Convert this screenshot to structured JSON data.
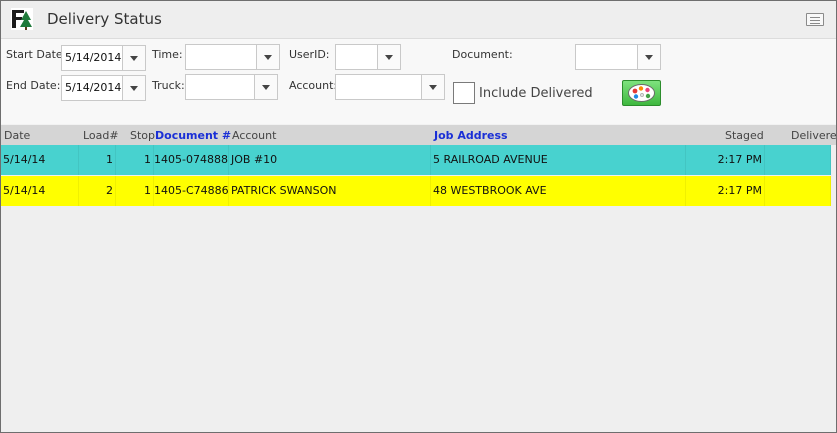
{
  "window": {
    "title": "Delivery Status"
  },
  "filters": {
    "start_date": {
      "label": "Start Date:",
      "value": "5/14/2014"
    },
    "end_date": {
      "label": "End Date:",
      "value": "5/14/2014"
    },
    "time": {
      "label": "Time:",
      "value": ""
    },
    "truck": {
      "label": "Truck:",
      "value": ""
    },
    "user_id": {
      "label": "UserID:",
      "value": ""
    },
    "account": {
      "label": "Account:",
      "value": ""
    },
    "document": {
      "label": "Document:",
      "value": ""
    },
    "include_delivered": {
      "label": "Include Delivered",
      "checked": false
    }
  },
  "table": {
    "columns": {
      "date": "Date",
      "load": "Load#",
      "stop": "Stop",
      "document": "Document #",
      "account": "Account",
      "job_address": "Job Address",
      "staged": "Staged",
      "delivered": "Delivere"
    },
    "rows": [
      {
        "date": "5/14/14",
        "load": "1",
        "stop": "1",
        "document": "1405-074888",
        "account": "JOB #10",
        "job_address": "5 RAILROAD AVENUE",
        "staged": "2:17 PM",
        "delivered": "",
        "color": "#48d2cf"
      },
      {
        "date": "5/14/14",
        "load": "2",
        "stop": "1",
        "document": "1405-C74886",
        "account": "PATRICK SWANSON",
        "job_address": "48 WESTBROOK AVE",
        "staged": "2:17 PM",
        "delivered": "",
        "color": "#ffff00"
      }
    ]
  },
  "colors": {
    "row_teal": "#48d2cf",
    "row_yellow": "#ffff00",
    "link_header": "#1a2fd6",
    "header_bg": "#d5d5d5"
  },
  "icons": {
    "app_logo": "tree-logo-icon",
    "menu": "menu-icon",
    "dropdown": "chevron-down-icon",
    "palette": "palette-icon"
  }
}
